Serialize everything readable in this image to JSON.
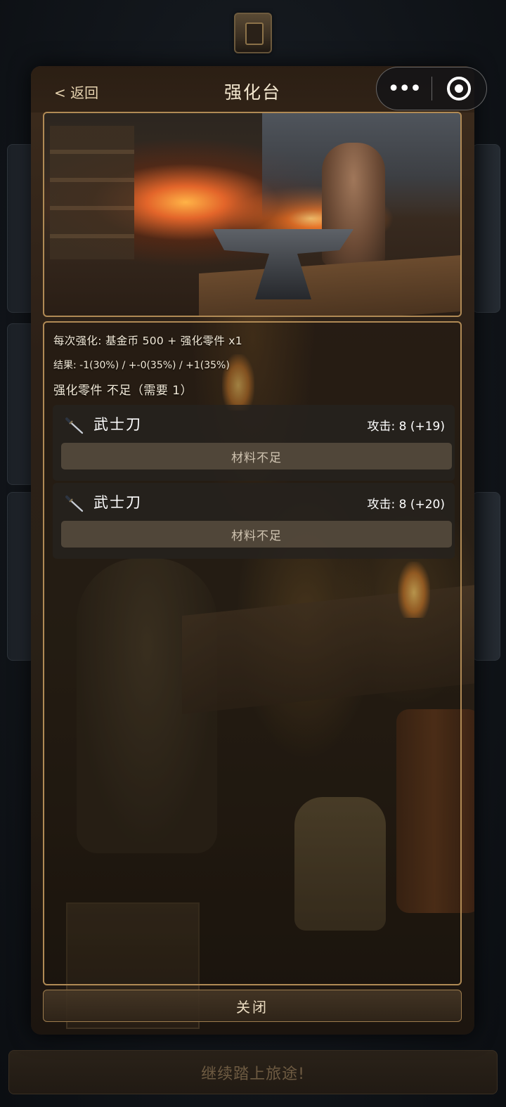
{
  "background": {
    "continue_button_label": "继续踏上旅途!"
  },
  "modal": {
    "back_label": "< 返回",
    "title": "强化台",
    "close_label": "关闭"
  },
  "capsule": {
    "more_icon": "more-dots-icon",
    "close_icon": "target-circle-icon"
  },
  "enhance": {
    "cost_text": "每次强化: 基金币 500 + 强化零件 x1",
    "result_text": "结果: -1(30%) / +-0(35%) / +1(35%)",
    "parts_status": "强化零件 不足（需要 1）"
  },
  "items": [
    {
      "icon": "katana-icon",
      "name": "武士刀",
      "stat": "攻击: 8 (+19)",
      "button_label": "材料不足"
    },
    {
      "icon": "katana-icon",
      "name": "武士刀",
      "stat": "攻击: 8 (+20)",
      "button_label": "材料不足"
    }
  ],
  "colors": {
    "frame_gold": "#b08a55",
    "text_light": "#f3ead8",
    "disabled_button": "#584c3e"
  }
}
